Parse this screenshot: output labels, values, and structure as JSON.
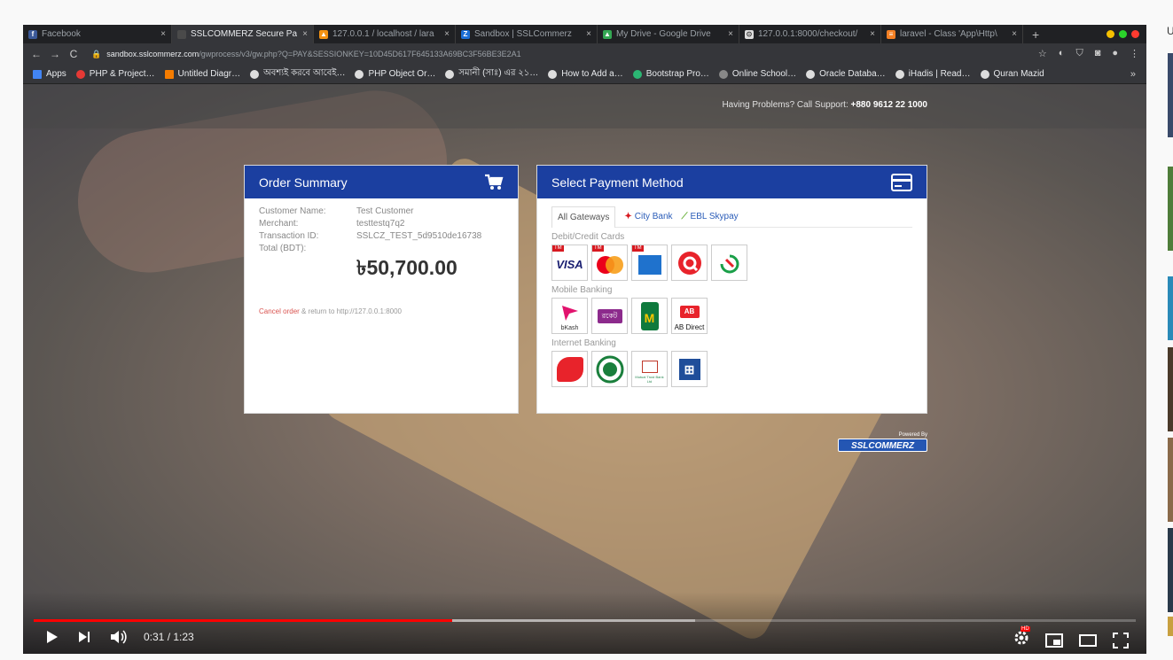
{
  "browser": {
    "tabs": [
      {
        "label": "Facebook",
        "active": false,
        "fav_color": "#3b5998",
        "fav_glyph": "f"
      },
      {
        "label": "SSLCOMMERZ Secure Pay",
        "active": true,
        "fav_color": "#4a4a4a",
        "fav_glyph": ""
      },
      {
        "label": "127.0.0.1 / localhost / lara",
        "active": false,
        "fav_color": "#f29111",
        "fav_glyph": "▲"
      },
      {
        "label": "Sandbox | SSLCommerz",
        "active": false,
        "fav_color": "#1c6fd6",
        "fav_glyph": "Z"
      },
      {
        "label": "My Drive - Google Drive",
        "active": false,
        "fav_color": "#34a853",
        "fav_glyph": "▲"
      },
      {
        "label": "127.0.0.1:8000/checkout/",
        "active": false,
        "fav_color": "#dddddd",
        "fav_glyph": "⊙"
      },
      {
        "label": "laravel - Class 'App\\Http\\",
        "active": false,
        "fav_color": "#f48024",
        "fav_glyph": "≡"
      }
    ],
    "new_tab": "+",
    "url_host": "sandbox.sslcommerz.com",
    "url_path": "/gwprocess/v3/gw.php?Q=PAY&SESSIONKEY=10D45D617F645133A69BC3F56BE3E2A1",
    "bookmarks": [
      {
        "label": "Apps",
        "color": "#4285f4"
      },
      {
        "label": "PHP & Project…",
        "color": "#e53935"
      },
      {
        "label": "Untitled Diagr…",
        "color": "#f57c00"
      },
      {
        "label": "অবশ্যই করবে আবেই…",
        "color": "#dddddd"
      },
      {
        "label": "PHP Object Or…",
        "color": "#dddddd"
      },
      {
        "label": "সমানী (সাঃ) এর ২১…",
        "color": "#dddddd"
      },
      {
        "label": "How to Add a…",
        "color": "#dddddd"
      },
      {
        "label": "Bootstrap Pro…",
        "color": "#2bb673"
      },
      {
        "label": "Online School…",
        "color": "#888888"
      },
      {
        "label": "Oracle Databa…",
        "color": "#dddddd"
      },
      {
        "label": "iHadis | Read…",
        "color": "#dddddd"
      },
      {
        "label": "Quran Mazid",
        "color": "#dddddd"
      }
    ],
    "bookmarks_more": "»"
  },
  "page": {
    "support_text": "Having Problems? Call Support:",
    "support_phone": "+880 9612 22 1000",
    "order": {
      "title": "Order Summary",
      "rows": [
        {
          "k": "Customer Name:",
          "v": "Test Customer"
        },
        {
          "k": "Merchant:",
          "v": "testtestq7q2"
        },
        {
          "k": "Transaction ID:",
          "v": "SSLCZ_TEST_5d9510de16738"
        },
        {
          "k": "Total (BDT):",
          "v": ""
        }
      ],
      "total": "৳50,700.00",
      "cancel_link": "Cancel order",
      "cancel_rest": " & return to http://127.0.0.1:8000"
    },
    "payment": {
      "title": "Select Payment Method",
      "tabs": [
        "All Gateways",
        "City Bank",
        "EBL Skypay"
      ],
      "sections": {
        "cards": "Debit/Credit Cards",
        "mobile": "Mobile Banking",
        "internet": "Internet Banking"
      },
      "cards": [
        {
          "name": "VISA",
          "badge": "TM"
        },
        {
          "name": "mastercard",
          "badge": "TM"
        },
        {
          "name": "AMEX",
          "badge": "TM"
        },
        {
          "name": "Q",
          "badge": ""
        },
        {
          "name": "NexusPay",
          "badge": ""
        }
      ],
      "mobile": [
        {
          "name": "bKash"
        },
        {
          "name": "রকেট"
        },
        {
          "name": "M"
        },
        {
          "name": "AB Direct"
        }
      ],
      "internet": [
        {
          "name": "City Touch"
        },
        {
          "name": "IBBL"
        },
        {
          "name": "Mutual Trust Bank Ltd"
        },
        {
          "name": "Bank Asia"
        }
      ]
    },
    "powered_by": "Powered By",
    "brand": "SSLCOMMERZ"
  },
  "player": {
    "time": "0:31 / 1:23",
    "progress_played": 0.38,
    "progress_buffered": 0.6,
    "hd_badge": "HD"
  },
  "sidebar": {
    "caption": "U"
  }
}
